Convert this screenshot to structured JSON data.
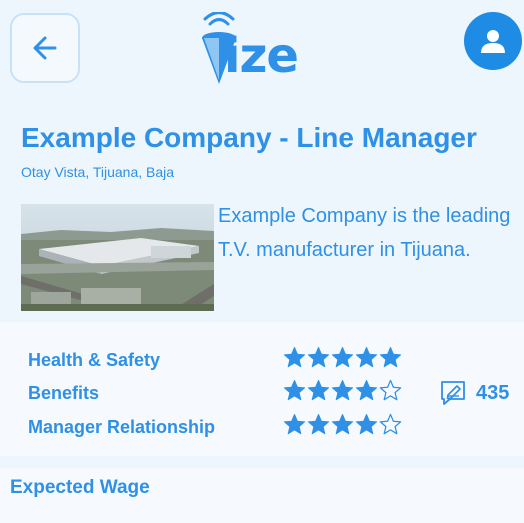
{
  "header": {
    "back_icon": "arrow-left-icon",
    "logo_text": "ize",
    "profile_icon": "person-icon"
  },
  "job": {
    "title": "Example Company - Line Manager",
    "location": "Otay Vista, Tijuana, Baja",
    "description": "Example Company is the leading T.V. manufacturer in Tijuana."
  },
  "ratings": [
    {
      "label": "Health & Safety",
      "stars": 5
    },
    {
      "label": "Benefits",
      "stars": 4
    },
    {
      "label": "Manager Relationship",
      "stars": 4
    }
  ],
  "reviews": {
    "icon": "review-edit-icon",
    "count": "435"
  },
  "wage": {
    "title": "Expected Wage"
  },
  "colors": {
    "accent": "#2e90e6",
    "background": "#eef6fd",
    "card": "#f6fafe"
  }
}
